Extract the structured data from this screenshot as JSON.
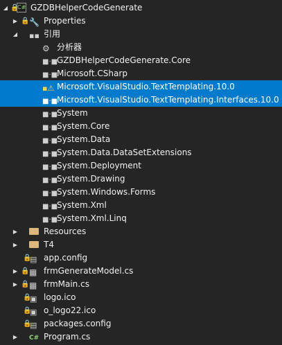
{
  "project": {
    "label": "GZDBHelperCodeGenerate"
  },
  "properties": {
    "label": "Properties"
  },
  "references": {
    "label": "引用",
    "items": [
      "分析器",
      "GZDBHelperCodeGenerate.Core",
      "Microsoft.CSharp",
      "Microsoft.VisualStudio.TextTemplating.10.0",
      "Microsoft.VisualStudio.TextTemplating.Interfaces.10.0",
      "System",
      "System.Core",
      "System.Data",
      "System.Data.DataSetExtensions",
      "System.Deployment",
      "System.Drawing",
      "System.Windows.Forms",
      "System.Xml",
      "System.Xml.Linq"
    ]
  },
  "folders": [
    "Resources",
    "T4"
  ],
  "files": [
    "app.config",
    "frmGenerateModel.cs",
    "frmMain.cs",
    "logo.ico",
    "o_logo22.ico",
    "packages.config",
    "Program.cs"
  ],
  "colors": {
    "background": "#252526",
    "selection": "#007acc",
    "text": "#f1f1f1"
  }
}
